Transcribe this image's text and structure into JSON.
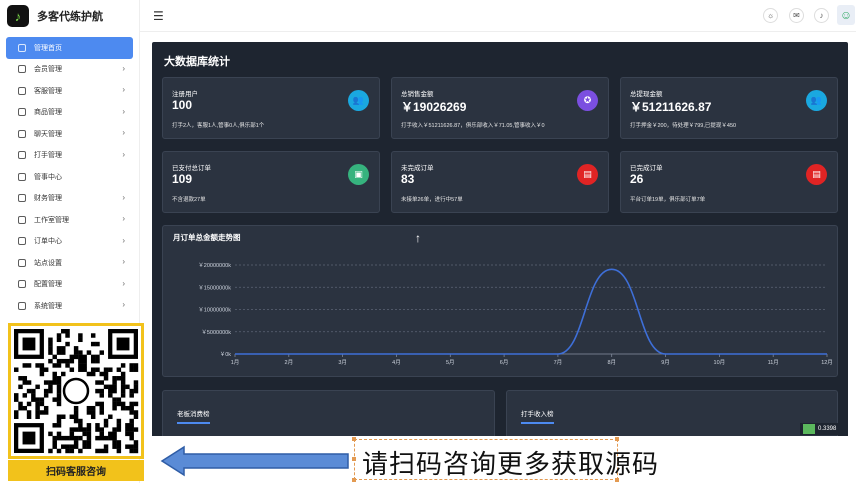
{
  "app": {
    "title": "多客代练护航"
  },
  "sidebar": {
    "items": [
      {
        "label": "管理首页",
        "active": true,
        "has_chevron": false
      },
      {
        "label": "会员管理",
        "has_chevron": true
      },
      {
        "label": "客服管理",
        "has_chevron": true
      },
      {
        "label": "商品管理",
        "has_chevron": true
      },
      {
        "label": "聊天管理",
        "has_chevron": true
      },
      {
        "label": "打手管理",
        "has_chevron": true
      },
      {
        "label": "管事中心",
        "has_chevron": false
      },
      {
        "label": "财务管理",
        "has_chevron": true
      },
      {
        "label": "工作室管理",
        "has_chevron": true
      },
      {
        "label": "订单中心",
        "has_chevron": true
      },
      {
        "label": "站点设置",
        "has_chevron": true
      },
      {
        "label": "配置管理",
        "has_chevron": true
      },
      {
        "label": "系统管理",
        "has_chevron": true
      }
    ],
    "qr_label": "扫码客服咨询"
  },
  "header": {
    "menu_icon": "hamburger-icon"
  },
  "main": {
    "title": "大数据库统计",
    "cards": [
      {
        "title": "注册用户",
        "value": "100",
        "sub": "打手2人，客服1人,管事0人,俱乐部1个",
        "icon": "users-icon",
        "color": "#1aa8e0"
      },
      {
        "title": "总销售金额",
        "value": "￥19026269",
        "sub": "打手收入￥51211626.87，俱乐部收入￥71.05,管事收入￥0",
        "icon": "medal-icon",
        "color": "#7b4fe0"
      },
      {
        "title": "总提现金额",
        "value": "￥51211626.87",
        "sub": "打手押金￥200，待处理￥799,已提现￥450",
        "icon": "users-icon",
        "color": "#1aa8e0"
      },
      {
        "title": "已支付总订单",
        "value": "109",
        "sub": "不含退款27单",
        "icon": "wallet-icon",
        "color": "#36b37e"
      },
      {
        "title": "未完成订单",
        "value": "83",
        "sub": "未接单26单，进行中57单",
        "icon": "file-icon",
        "color": "#e02424"
      },
      {
        "title": "已完成订单",
        "value": "26",
        "sub": "平台订单19单，俱乐部订单7单",
        "icon": "file-icon",
        "color": "#e02424"
      }
    ],
    "chart_title": "月订单总金额走势图",
    "bottom_left_title": "老板消费榜",
    "bottom_right_title": "打手收入榜"
  },
  "chart_data": {
    "type": "line",
    "title": "月订单总金额走势图",
    "x": [
      "1月",
      "2月",
      "3月",
      "4月",
      "5月",
      "6月",
      "7月",
      "8月",
      "9月",
      "10月",
      "11月",
      "12月"
    ],
    "series": [
      {
        "values": [
          0,
          0,
          0,
          0,
          0,
          0,
          0,
          19026269,
          0,
          0,
          0,
          0
        ]
      }
    ],
    "ytick_labels": [
      "￥0k",
      "￥5000000k",
      "￥10000000k",
      "￥15000000k",
      "￥20000000k"
    ],
    "ylim": [
      0,
      20000000
    ],
    "grid": true,
    "color": "#3e6fd8"
  },
  "banner": {
    "text": "请扫码咨询更多获取源码"
  },
  "version": {
    "text": "0.3398"
  }
}
